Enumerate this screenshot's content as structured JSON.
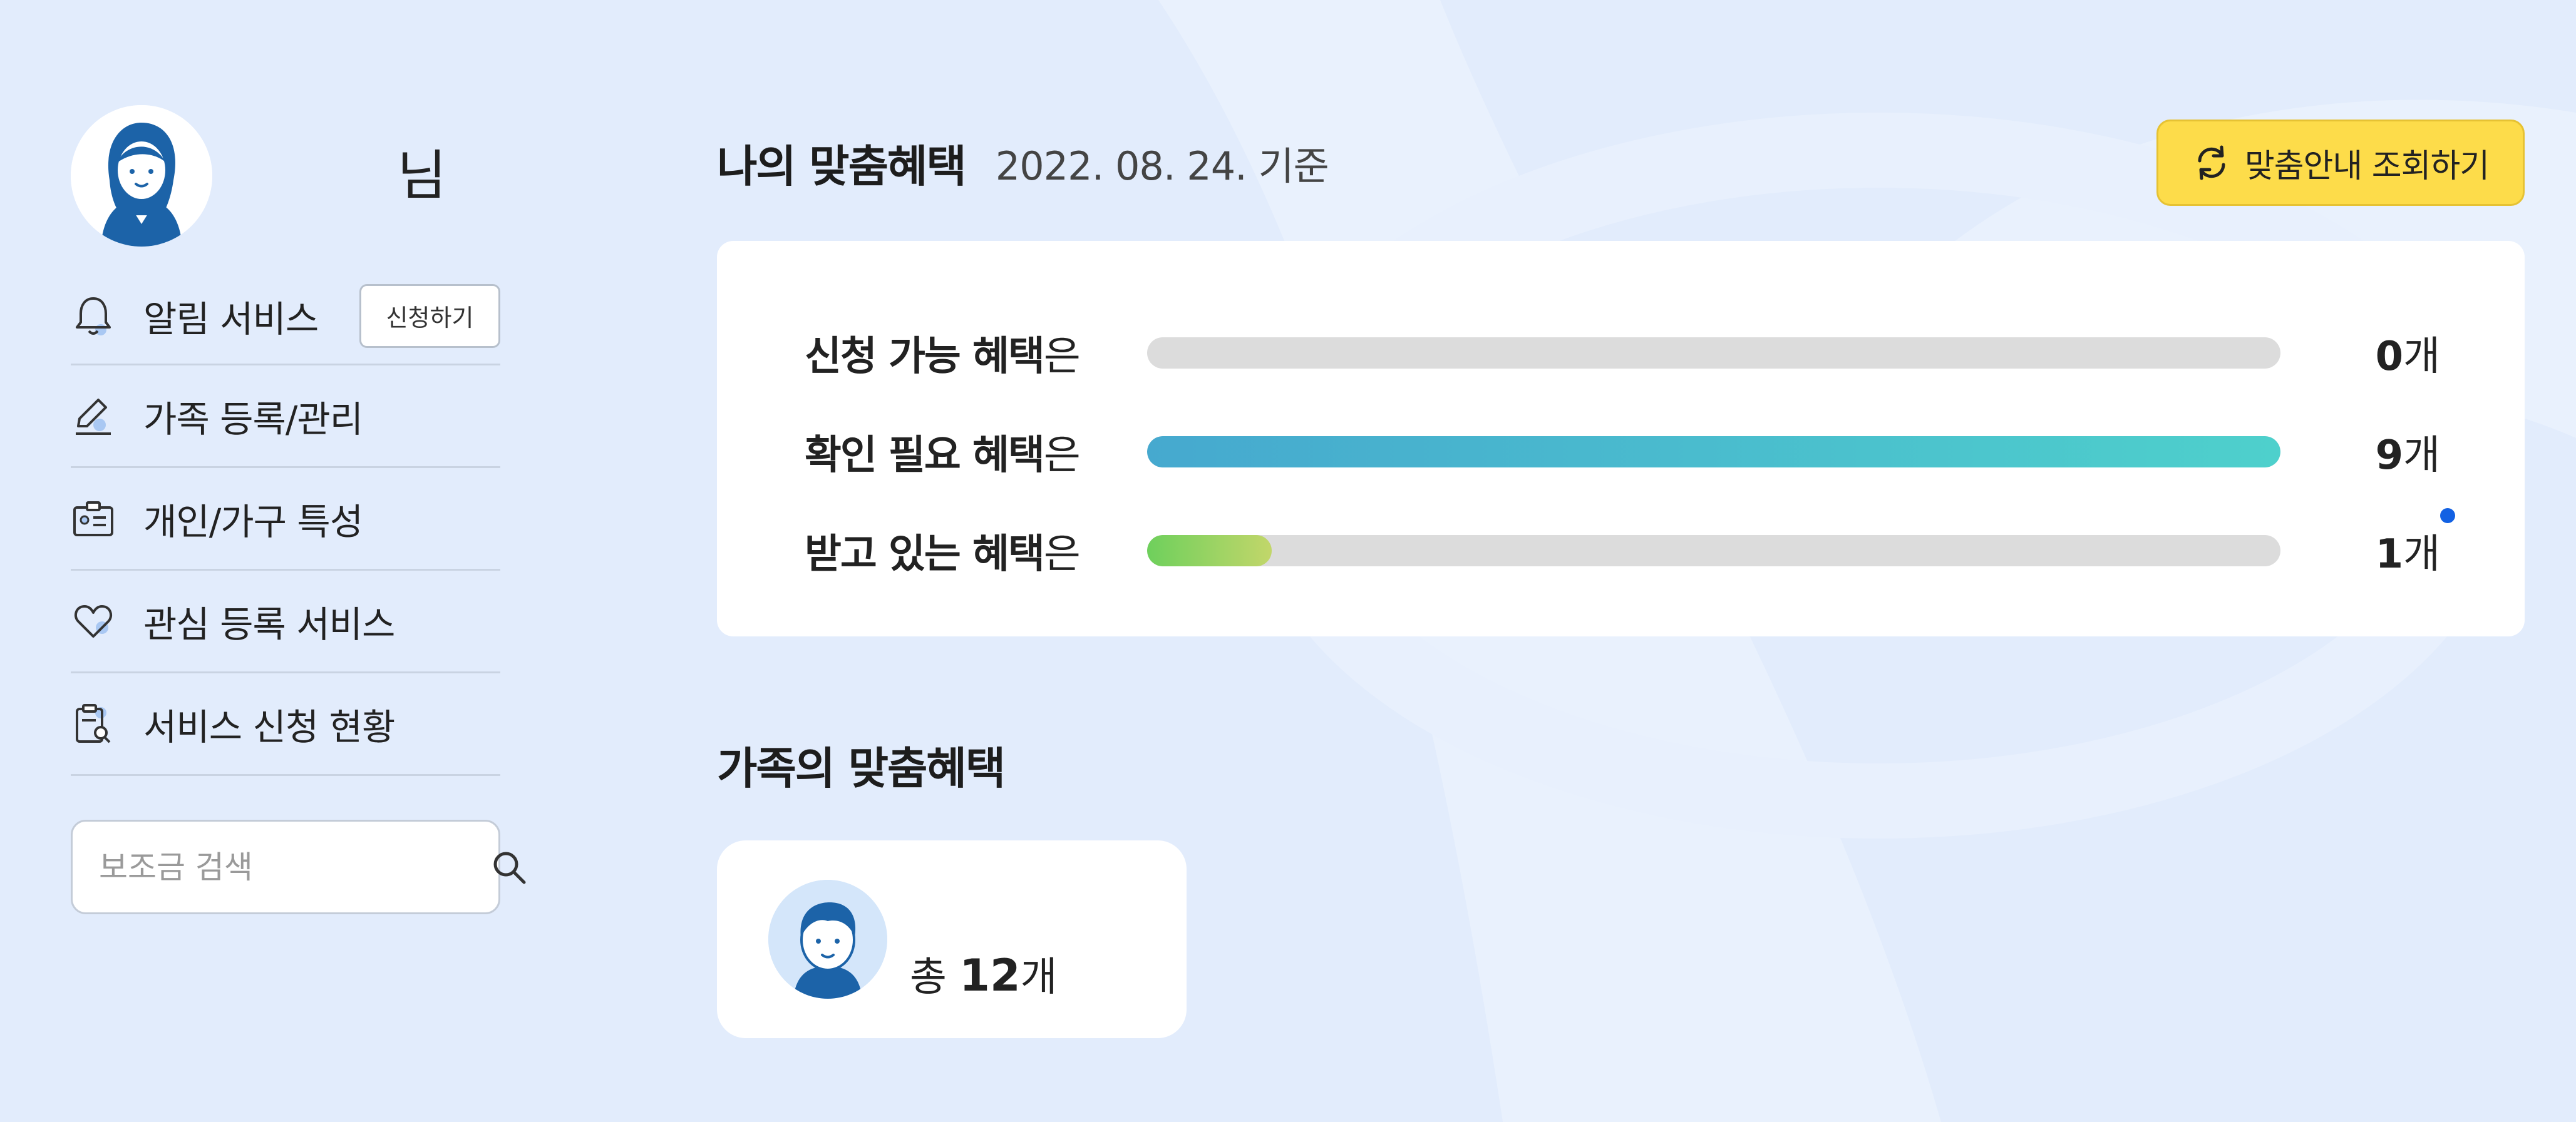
{
  "sidebar": {
    "user_suffix": "님",
    "menu": [
      {
        "icon": "bell-icon",
        "label": "알림 서비스",
        "button": "신청하기"
      },
      {
        "icon": "pencil-icon",
        "label": "가족 등록/관리"
      },
      {
        "icon": "id-card-icon",
        "label": "개인/가구 특성"
      },
      {
        "icon": "heart-icon",
        "label": "관심 등록 서비스"
      },
      {
        "icon": "clipboard-search-icon",
        "label": "서비스 신청 현황"
      }
    ],
    "search": {
      "placeholder": "보조금 검색",
      "value": ""
    }
  },
  "my_benefits": {
    "title": "나의 맞춤혜택",
    "date": "2022. 08. 24. 기준",
    "refresh_button": "맞춤안내 조회하기",
    "rows": [
      {
        "label_bold": "신청 가능 혜택",
        "label_suffix": "은",
        "count": "0",
        "unit": "개",
        "fill": 0,
        "style": "none"
      },
      {
        "label_bold": "확인 필요 혜택",
        "label_suffix": "은",
        "count": "9",
        "unit": "개",
        "fill": 1.0,
        "style": "teal"
      },
      {
        "label_bold": "받고 있는 혜택",
        "label_suffix": "은",
        "count": "1",
        "unit": "개",
        "fill": 0.11,
        "style": "green",
        "new": true
      }
    ]
  },
  "family_benefits": {
    "title": "가족의 맞춤혜택",
    "total_prefix": "총 ",
    "total_count": "12",
    "total_unit": "개"
  },
  "colors": {
    "background": "#e2ecfc",
    "accent_yellow": "#fddc4a",
    "bar_teal_start": "#46a9cf",
    "bar_teal_end": "#4ed0cc",
    "bar_green_start": "#6ed05c",
    "bar_green_end": "#c2d66a",
    "badge_dot": "#1261e3",
    "icon_blue": "#1c63a8"
  }
}
